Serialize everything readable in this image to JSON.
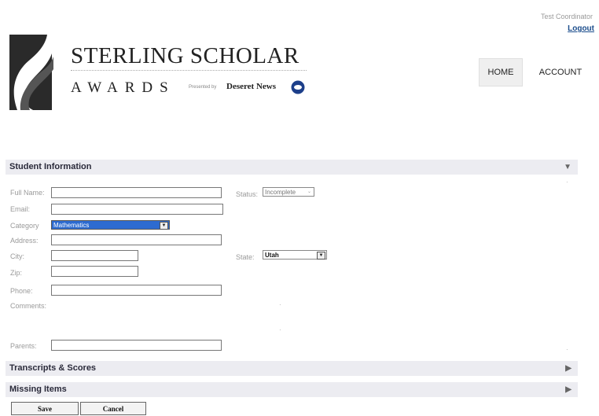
{
  "header": {
    "user_role": "Test Coordinator",
    "logout_label": "Logout",
    "brand_title": "STERLING SCHOLAR",
    "brand_subtitle": "AWARDS",
    "presented_by": "Presented by",
    "paper_name": "Deseret News",
    "nav": {
      "home": "HOME",
      "account": "ACCOUNT"
    }
  },
  "sections": {
    "student_info": "Student Information",
    "transcripts": "Transcripts & Scores",
    "missing": "Missing Items"
  },
  "form": {
    "labels": {
      "full_name": "Full Name:",
      "email": "Email:",
      "category": "Category",
      "address": "Address:",
      "city": "City:",
      "zip": "Zip:",
      "phone": "Phone:",
      "comments": "Comments:",
      "parents": "Parents:",
      "status": "Status:",
      "state": "State:"
    },
    "values": {
      "full_name": "",
      "email": "",
      "category": "Mathematics",
      "address": "",
      "city": "",
      "zip": "",
      "phone": "",
      "parents": "",
      "status": "Incomplete",
      "state": "Utah"
    }
  },
  "buttons": {
    "save": "Save",
    "cancel": "Cancel"
  },
  "colors": {
    "section_bg": "#ececf1",
    "link": "#1b4d8c",
    "selection": "#2d6bd0"
  }
}
